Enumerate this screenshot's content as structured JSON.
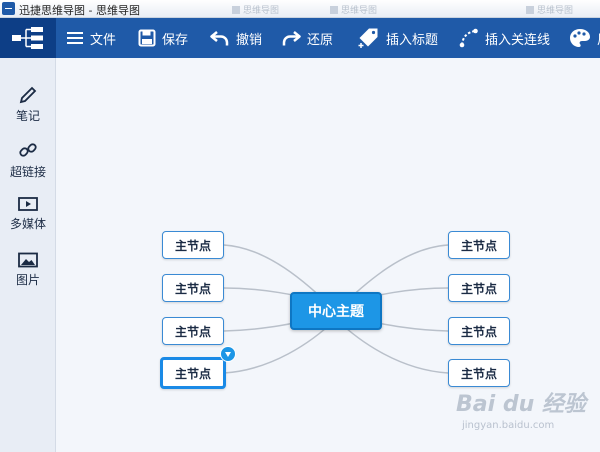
{
  "titlebar": {
    "title": "迅捷思维导图 - 思维导图",
    "ghost_tabs": [
      "思维导图",
      "思维导图",
      "思维导图"
    ]
  },
  "toolbar": {
    "items": [
      {
        "label": "文件",
        "icon": "menu-icon"
      },
      {
        "label": "保存",
        "icon": "save-icon"
      },
      {
        "label": "撤销",
        "icon": "undo-icon"
      },
      {
        "label": "还原",
        "icon": "redo-icon"
      },
      {
        "label": "插入标题",
        "icon": "tag-icon"
      },
      {
        "label": "插入关连线",
        "icon": "connector-icon"
      },
      {
        "label": "风",
        "icon": "palette-icon"
      }
    ]
  },
  "sidebar": {
    "items": [
      {
        "label": "笔记",
        "icon": "pencil-icon"
      },
      {
        "label": "超链接",
        "icon": "link-icon"
      },
      {
        "label": "多媒体",
        "icon": "film-icon"
      },
      {
        "label": "图片",
        "icon": "image-icon"
      }
    ]
  },
  "mindmap": {
    "center": "中心主题",
    "left_nodes": [
      "主节点",
      "主节点",
      "主节点",
      "主节点"
    ],
    "right_nodes": [
      "主节点",
      "主节点",
      "主节点",
      "主节点"
    ]
  },
  "watermark": {
    "brand": "Bai du 经验",
    "url": "jingyan.baidu.com"
  },
  "colors": {
    "toolbar": "#1f5aa8",
    "accent": "#1d96e6",
    "node_border": "#3a8ad4"
  }
}
